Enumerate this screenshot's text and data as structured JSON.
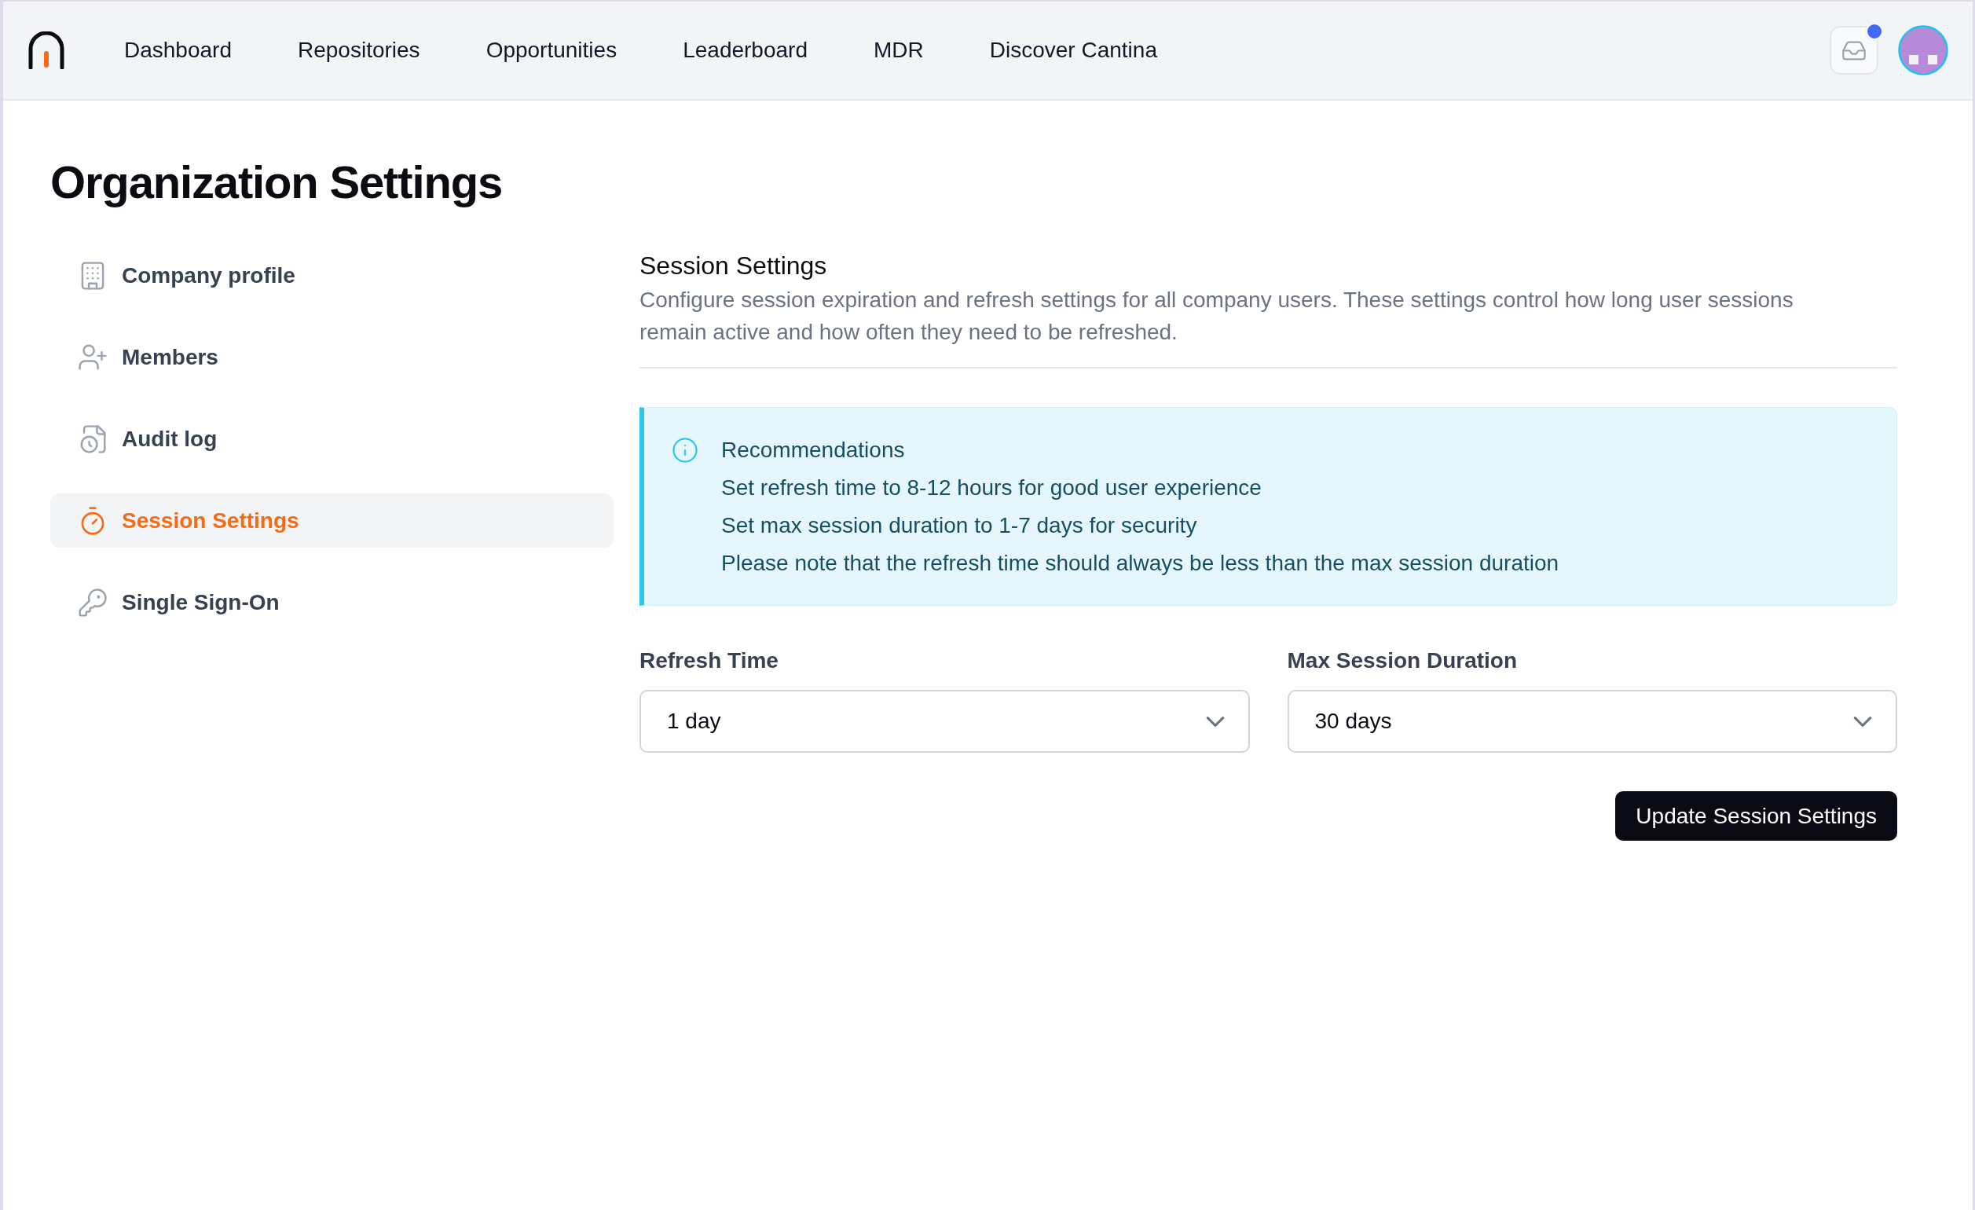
{
  "header": {
    "nav_links": [
      "Dashboard",
      "Repositories",
      "Opportunities",
      "Leaderboard",
      "MDR",
      "Discover Cantina"
    ],
    "inbox": {
      "unread": true
    }
  },
  "page_title": "Organization Settings",
  "sidebar": {
    "items": [
      {
        "label": "Company profile",
        "selected": false
      },
      {
        "label": "Members",
        "selected": false
      },
      {
        "label": "Audit log",
        "selected": false
      },
      {
        "label": "Session Settings",
        "selected": true
      },
      {
        "label": "Single Sign-On",
        "selected": false
      }
    ]
  },
  "session_settings": {
    "title": "Session Settings",
    "description": "Configure session expiration and refresh settings for all company users. These settings control how long user sessions remain active and how often they need to be refreshed.",
    "recommendations": {
      "title": "Recommendations",
      "lines": [
        "Set refresh time to 8-12 hours for good user experience",
        "Set max session duration to 1-7 days for security",
        "Please note that the refresh time should always be less than the max session duration"
      ]
    },
    "fields": [
      {
        "label": "Refresh Time",
        "value": "1 day"
      },
      {
        "label": "Max Session Duration",
        "value": "30 days"
      }
    ],
    "submit_button": "Update Session Settings"
  }
}
